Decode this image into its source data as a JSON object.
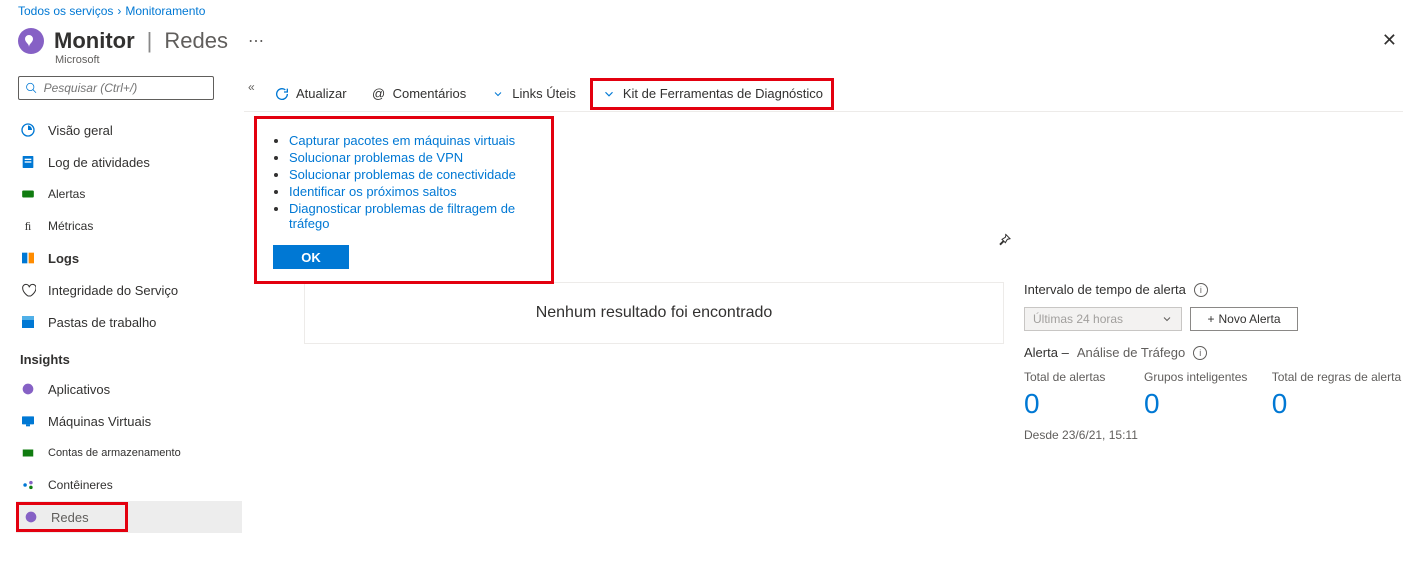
{
  "breadcrumb": {
    "item1": "Todos os serviços",
    "item2": "Monitoramento"
  },
  "header": {
    "title": "Monitor",
    "subtitle": "Redes",
    "company": "Microsoft",
    "dots": "⋯",
    "close": "✕"
  },
  "search": {
    "placeholder": "Pesquisar (Ctrl+/)"
  },
  "collapse": "«",
  "nav": {
    "visao": "Visão geral",
    "log": "Log de atividades",
    "alertas": "Alertas",
    "metricas": "Métricas",
    "logs": "Logs",
    "integridade": "Integridade do Serviço",
    "pastas": "Pastas de trabalho",
    "section": "Insights",
    "aplicativos": "Aplicativos",
    "maquinas": "Máquinas Virtuais",
    "contas": "Contas de armazenamento",
    "conteineres": "Contêineres",
    "redes": "Redes"
  },
  "toolbar": {
    "atualizar": "Atualizar",
    "comentarios": "Comentários",
    "links": "Links Úteis",
    "diag": "Kit de Ferramentas de Diagnóstico"
  },
  "panel": {
    "i1": "Capturar pacotes em máquinas virtuais",
    "i2": "Solucionar problemas de VPN",
    "i3": "Solucionar problemas de conectividade",
    "i4": "Identificar os próximos saltos",
    "i5": "Diagnosticar problemas de filtragem de tráfego",
    "ok": "OK"
  },
  "empty": "Nenhum resultado foi encontrado",
  "right": {
    "interval_label": "Intervalo de tempo de alerta",
    "interval_value": "Últimas 24 horas",
    "new_alert": "Novo Alerta",
    "alert_title_prefix": "Alerta – ",
    "alert_title": "Análise de Tráfego",
    "stat1_label": "Total de alertas",
    "stat2_label": "Grupos inteligentes",
    "stat3_label": "Total de regras de alerta",
    "stat1_val": "0",
    "stat2_val": "0",
    "stat3_val": "0",
    "since": "Desde 23/6/21, 15:11"
  }
}
